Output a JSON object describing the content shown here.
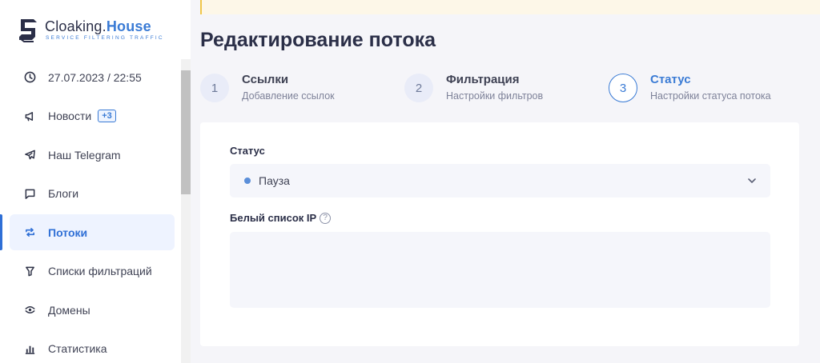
{
  "brand": {
    "name_prefix": "Cloaking.",
    "name_accent": "House",
    "tagline": "SERVICE FILTERING TRAFFIC"
  },
  "sidebar": {
    "items": [
      {
        "label": "27.07.2023 / 22:55",
        "icon": "clock-icon"
      },
      {
        "label": "Новости",
        "icon": "megaphone-icon",
        "badge": "+3"
      },
      {
        "label": "Наш Telegram",
        "icon": "telegram-icon"
      },
      {
        "label": "Блоги",
        "icon": "chat-icon"
      },
      {
        "label": "Потоки",
        "icon": "flows-icon",
        "active": true
      },
      {
        "label": "Списки фильтраций",
        "icon": "filter-icon"
      },
      {
        "label": "Домены",
        "icon": "domain-icon"
      },
      {
        "label": "Статистика",
        "icon": "stats-icon"
      }
    ]
  },
  "main": {
    "title": "Редактирование потока",
    "steps": [
      {
        "number": "1",
        "title": "Ссылки",
        "subtitle": "Добавление ссылок"
      },
      {
        "number": "2",
        "title": "Фильтрация",
        "subtitle": "Настройки фильтров"
      },
      {
        "number": "3",
        "title": "Статус",
        "subtitle": "Настройки статуса потока",
        "current": true
      }
    ],
    "form": {
      "status_label": "Статус",
      "status_value": "Пауза",
      "whitelist_label": "Белый список IP",
      "whitelist_help": "?",
      "whitelist_value": ""
    }
  },
  "colors": {
    "accent": "#3a7bd5",
    "status_dot": "#5b8fd9",
    "notice_border": "#f0c649"
  }
}
